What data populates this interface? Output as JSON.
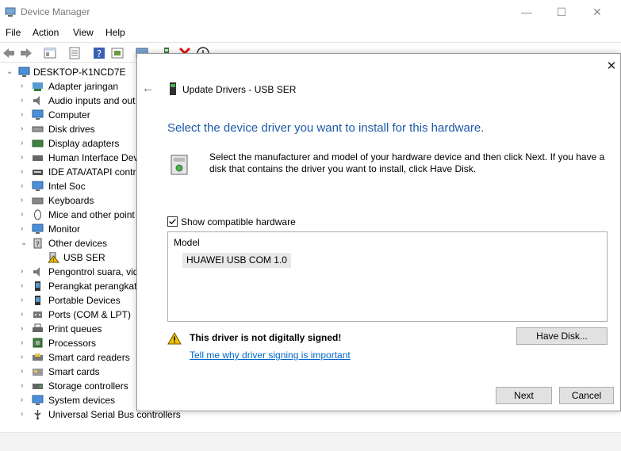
{
  "window": {
    "title": "Device Manager",
    "controls": {
      "minimize": "—",
      "maximize": "☐",
      "close": "✕"
    }
  },
  "menu": [
    "File",
    "Action",
    "View",
    "Help"
  ],
  "tree": {
    "root": "DESKTOP-K1NCD7E",
    "items": [
      {
        "label": "Adapter jaringan",
        "icon": "network-adapter-icon",
        "expanded": false
      },
      {
        "label": "Audio inputs and out",
        "icon": "audio-icon",
        "expanded": false
      },
      {
        "label": "Computer",
        "icon": "computer-icon",
        "expanded": false
      },
      {
        "label": "Disk drives",
        "icon": "disk-drive-icon",
        "expanded": false
      },
      {
        "label": "Display adapters",
        "icon": "display-adapter-icon",
        "expanded": false
      },
      {
        "label": "Human Interface Dev",
        "icon": "hid-icon",
        "expanded": false
      },
      {
        "label": "IDE ATA/ATAPI contro",
        "icon": "ide-controller-icon",
        "expanded": false
      },
      {
        "label": "Intel Soc",
        "icon": "chip-monitor-icon",
        "expanded": false
      },
      {
        "label": "Keyboards",
        "icon": "keyboard-icon",
        "expanded": false
      },
      {
        "label": "Mice and other point",
        "icon": "mouse-icon",
        "expanded": false
      },
      {
        "label": "Monitor",
        "icon": "monitor-icon",
        "expanded": false
      },
      {
        "label": "Other devices",
        "icon": "other-devices-icon",
        "expanded": true
      },
      {
        "label": "USB SER",
        "icon": "warning-device-icon",
        "child": true
      },
      {
        "label": "Pengontrol suara, vid",
        "icon": "sound-controller-icon",
        "expanded": false
      },
      {
        "label": "Perangkat perangkat",
        "icon": "portable-device-icon",
        "expanded": false
      },
      {
        "label": "Portable Devices",
        "icon": "portable-devices-icon",
        "expanded": false
      },
      {
        "label": "Ports (COM & LPT)",
        "icon": "ports-icon",
        "expanded": false
      },
      {
        "label": "Print queues",
        "icon": "printer-icon",
        "expanded": false
      },
      {
        "label": "Processors",
        "icon": "processor-icon",
        "expanded": false
      },
      {
        "label": "Smart card readers",
        "icon": "card-reader-icon",
        "expanded": false
      },
      {
        "label": "Smart cards",
        "icon": "smart-card-icon",
        "expanded": false
      },
      {
        "label": "Storage controllers",
        "icon": "storage-controller-icon",
        "expanded": false
      },
      {
        "label": "System devices",
        "icon": "system-devices-icon",
        "expanded": false
      },
      {
        "label": "Universal Serial Bus controllers",
        "icon": "usb-icon",
        "expanded": false
      }
    ]
  },
  "dialog": {
    "close": "✕",
    "back": "←",
    "header_title": "Update Drivers - USB SER",
    "heading": "Select the device driver you want to install for this hardware.",
    "instructions": "Select the manufacturer and model of your hardware device and then click Next. If you have a disk that contains the driver you want to install, click Have Disk.",
    "show_compatible_label": "Show compatible hardware",
    "show_compatible_checked": true,
    "model_column_header": "Model",
    "models": [
      "HUAWEI USB COM 1.0"
    ],
    "warning_text": "This driver is not digitally signed!",
    "warning_link": "Tell me why driver signing is important",
    "have_disk_label": "Have Disk...",
    "next_label": "Next",
    "cancel_label": "Cancel"
  },
  "colors": {
    "heading_blue": "#1d5aa8",
    "link_blue": "#0066cc",
    "warning_yellow": "#f2c200",
    "button_gray": "#e1e1e1"
  }
}
